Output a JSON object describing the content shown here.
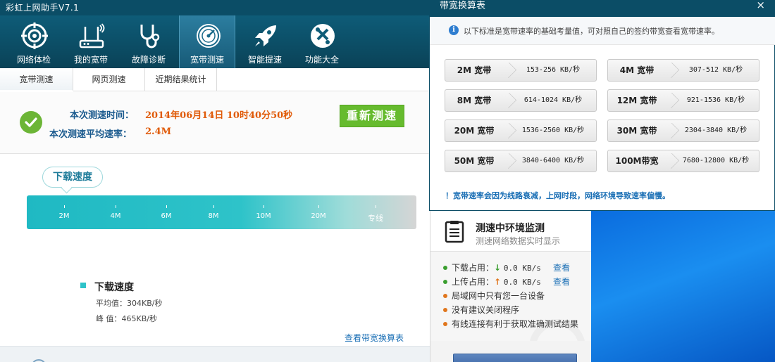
{
  "app": {
    "title": "彩虹上网助手V7.1",
    "toolbar": [
      {
        "label": "网络体检",
        "icon": "target-icon"
      },
      {
        "label": "我的宽带",
        "icon": "router-icon"
      },
      {
        "label": "故障诊断",
        "icon": "stethoscope-icon"
      },
      {
        "label": "宽带测速",
        "icon": "speedometer-icon",
        "active": true
      },
      {
        "label": "智能提速",
        "icon": "rocket-icon"
      },
      {
        "label": "功能大全",
        "icon": "toolbox-icon"
      }
    ],
    "subtabs": [
      "宽带测速",
      "网页测速",
      "近期结果统计"
    ],
    "result": {
      "time_label": "本次测速时间：",
      "time_value": "2014年06月14日 10时40分50秒",
      "rate_label": "本次测速平均速率：",
      "rate_value": "2.4M",
      "retest_label": "重新测速"
    },
    "gauge": {
      "bubble_label": "下载速度",
      "ticks": [
        "2M",
        "4M",
        "6M",
        "8M",
        "10M",
        "20M",
        "专线"
      ]
    },
    "stats": {
      "title": "下载速度",
      "avg": "平均值：304KB/秒",
      "peak": "峰  值：465KB/秒"
    },
    "link_calc": "查看带宽换算表"
  },
  "side": {
    "title": "测速中环境监测",
    "subtitle": "测速网络数据实时显示",
    "items": [
      {
        "label": "下载占用：",
        "value": "0.0 KB/s",
        "arrow": "↓",
        "arrow_color": "#3a9e2f",
        "dot_color": "#3a9e2f",
        "action": "查看"
      },
      {
        "label": "上传占用：",
        "value": "0.0 KB/s",
        "arrow": "↑",
        "arrow_color": "#e0761d",
        "dot_color": "#3a9e2f",
        "action": "查看"
      },
      {
        "label": "局域网中只有您一台设备",
        "dot_color": "#e0761d"
      },
      {
        "label": "没有建议关闭程序",
        "dot_color": "#e0761d"
      },
      {
        "label": "有线连接有利于获取准确测试结果",
        "dot_color": "#e0761d"
      }
    ]
  },
  "dialog": {
    "title": "带宽换算表",
    "close_label": "×",
    "info": "以下标准是宽带速率的基础考量值，可对照自己的签约带宽查看宽带速率。",
    "rows": [
      {
        "bw": "2M  宽带",
        "rate": "153-256 KB/秒"
      },
      {
        "bw": "4M  宽带",
        "rate": "307-512 KB/秒"
      },
      {
        "bw": "8M  宽带",
        "rate": "614-1024 KB/秒"
      },
      {
        "bw": "12M 宽带",
        "rate": "921-1536 KB/秒"
      },
      {
        "bw": "20M 宽带",
        "rate": "1536-2560 KB/秒"
      },
      {
        "bw": "30M 宽带",
        "rate": "2304-3840 KB/秒"
      },
      {
        "bw": "50M 宽带",
        "rate": "3840-6400 KB/秒"
      },
      {
        "bw": "100M带宽",
        "rate": "7680-12800 KB/秒"
      }
    ],
    "note": "！宽带速率会因为线路衰减，上网时段，网络环境导致速率偏慢。"
  },
  "colors": {
    "header": "#0b4d66",
    "accent_orange": "#e05a07",
    "button_green": "#66bb2e",
    "gauge_teal": "#2ec3c9",
    "link_blue": "#1a6fb5"
  }
}
